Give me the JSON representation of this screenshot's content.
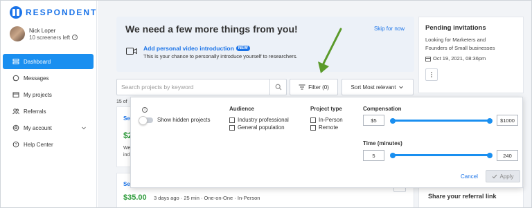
{
  "app": {
    "brand": "RESPONDENT",
    "brand_color": "#1a73e8"
  },
  "profile": {
    "name": "Nick Loper",
    "screeners_left": "10 screeners left"
  },
  "nav": {
    "items": [
      {
        "label": "Dashboard",
        "icon": "dashboard-icon",
        "active": true
      },
      {
        "label": "Messages",
        "icon": "message-icon"
      },
      {
        "label": "My projects",
        "icon": "folder-icon"
      },
      {
        "label": "Referrals",
        "icon": "people-icon"
      },
      {
        "label": "My account",
        "icon": "gear-icon"
      },
      {
        "label": "Help Center",
        "icon": "help-icon"
      }
    ]
  },
  "banner": {
    "title": "We need a few more things from you!",
    "skip": "Skip for now",
    "video_title": "Add personal video introduction",
    "new_badge": "NEW",
    "video_sub": "This is your chance to personally introduce yourself to researchers."
  },
  "toolbar": {
    "search_placeholder": "Search projects by keyword",
    "filter_label": "Filter (0)",
    "sort_label": "Sort Most relevant"
  },
  "results": {
    "count_prefix": "15 of"
  },
  "card1": {
    "title": "Se",
    "price": "$2",
    "desc1": "We",
    "desc2": "ind"
  },
  "card2": {
    "title": "Se",
    "price": "$35.00",
    "meta": "3 days ago · 25 min · One-on-One · In-Person"
  },
  "invitations": {
    "title": "Pending invitations",
    "line1": "Looking for Marketers and",
    "line2": "Founders of Small businesses",
    "date": "Oct 19, 2021, 08:36pm"
  },
  "referral": {
    "title": "Share your referral link"
  },
  "filter_popup": {
    "show_hidden": "Show hidden projects",
    "audience": {
      "title": "Audience",
      "options": [
        "Industry professional",
        "General population"
      ]
    },
    "project_type": {
      "title": "Project type",
      "options": [
        "In-Person",
        "Remote"
      ]
    },
    "compensation": {
      "title": "Compensation",
      "min": "$5",
      "max": "$1000",
      "min_fraction": 0,
      "max_fraction": 1
    },
    "time": {
      "title": "Time (minutes)",
      "min": "5",
      "max": "240",
      "min_fraction": 0,
      "max_fraction": 1
    },
    "cancel": "Cancel",
    "apply": "Apply"
  },
  "annotation": {
    "arrow_color": "#5a9a2a"
  }
}
